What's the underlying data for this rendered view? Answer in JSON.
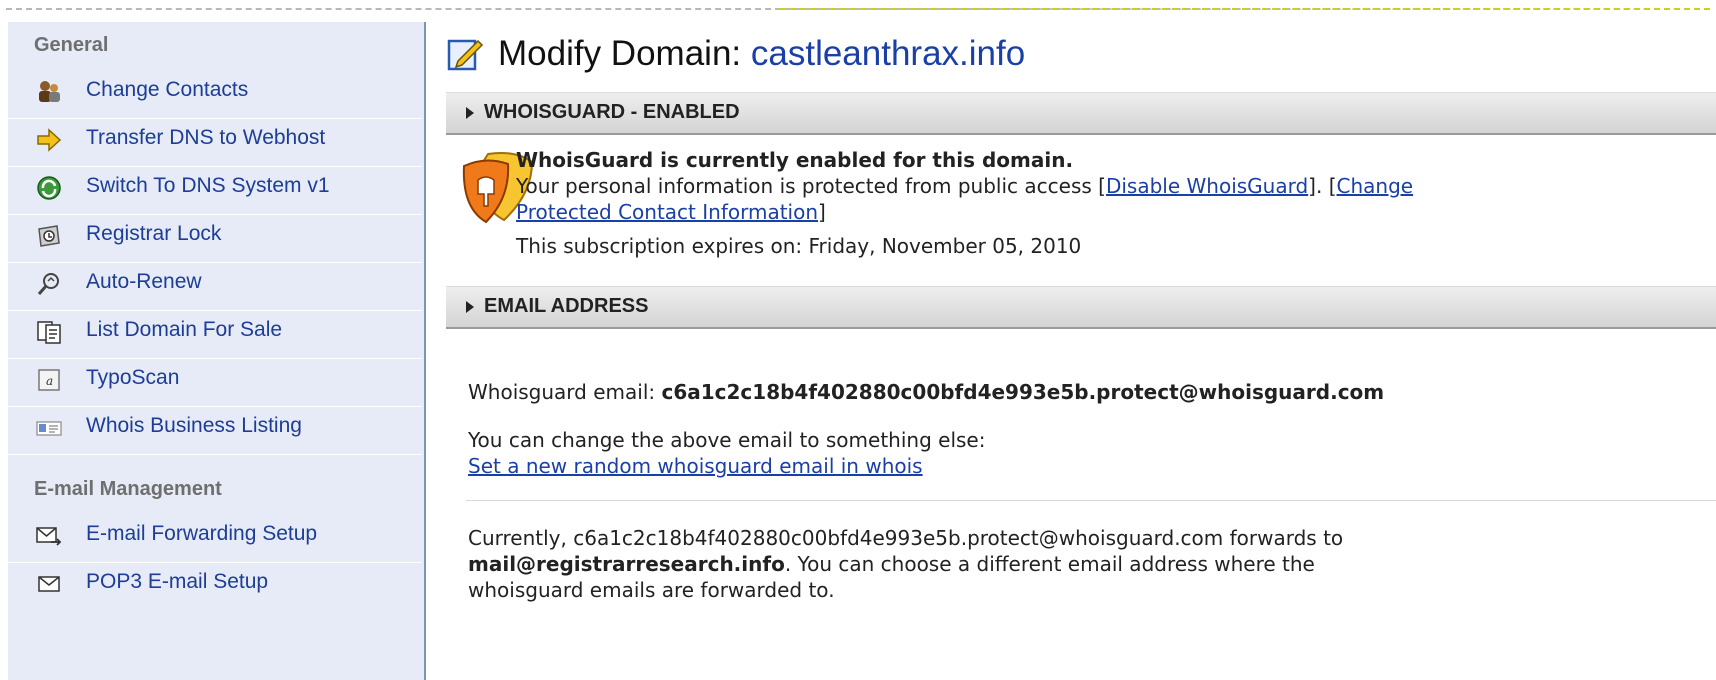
{
  "sidebar": {
    "general_heading": "General",
    "general_items": [
      {
        "label": "Change Contacts",
        "icon": "contacts-icon"
      },
      {
        "label": "Transfer DNS to Webhost",
        "icon": "arrow-right-icon"
      },
      {
        "label": "Switch To DNS System v1",
        "icon": "dns-switch-icon"
      },
      {
        "label": "Registrar Lock",
        "icon": "lock-icon"
      },
      {
        "label": "Auto-Renew",
        "icon": "auto-renew-icon"
      },
      {
        "label": "List Domain For Sale",
        "icon": "list-sale-icon"
      },
      {
        "label": "TypoScan",
        "icon": "typoscan-icon"
      },
      {
        "label": "Whois Business Listing",
        "icon": "business-card-icon"
      }
    ],
    "email_heading": "E-mail Management",
    "email_items": [
      {
        "label": "E-mail Forwarding Setup",
        "icon": "email-forward-icon"
      },
      {
        "label": "POP3 E-mail Setup",
        "icon": "envelope-icon"
      }
    ]
  },
  "main": {
    "title_prefix": "Modify Domain:",
    "title_domain": "castleanthrax.info",
    "whoisguard_section": {
      "header": "WHOISGUARD - ENABLED",
      "status_heading": "WhoisGuard is currently enabled for this domain.",
      "info_text": "Your personal information is protected from public access [",
      "disable_link": "Disable WhoisGuard",
      "info_between": "]. [",
      "change_link_part1": "Change",
      "change_link_part2": "Protected Contact Information",
      "info_close": "]",
      "expiry_text": "This subscription expires on: Friday, November 05, 2010"
    },
    "email_section": {
      "header": "EMAIL ADDRESS",
      "whoisguard_email_label": "Whoisguard email:",
      "whoisguard_email_value": "c6a1c2c18b4f402880c00bfd4e993e5b.protect@whoisguard.com",
      "change_text": "You can change the above email to something else:",
      "random_link": "Set a new random whoisguard email in whois",
      "currently_text": "Currently, c6a1c2c18b4f402880c00bfd4e993e5b.protect@whoisguard.com forwards to",
      "forward_address": "mail@registrarresearch.info",
      "forward_tail": ". You can choose a different email address where the",
      "forward_tail2": "whoisguard emails are forwarded to."
    }
  },
  "colors": {
    "sidebar_bg": "#e6ebf7",
    "link": "#1a3fa6",
    "section_bar": "#d8d8d8"
  }
}
